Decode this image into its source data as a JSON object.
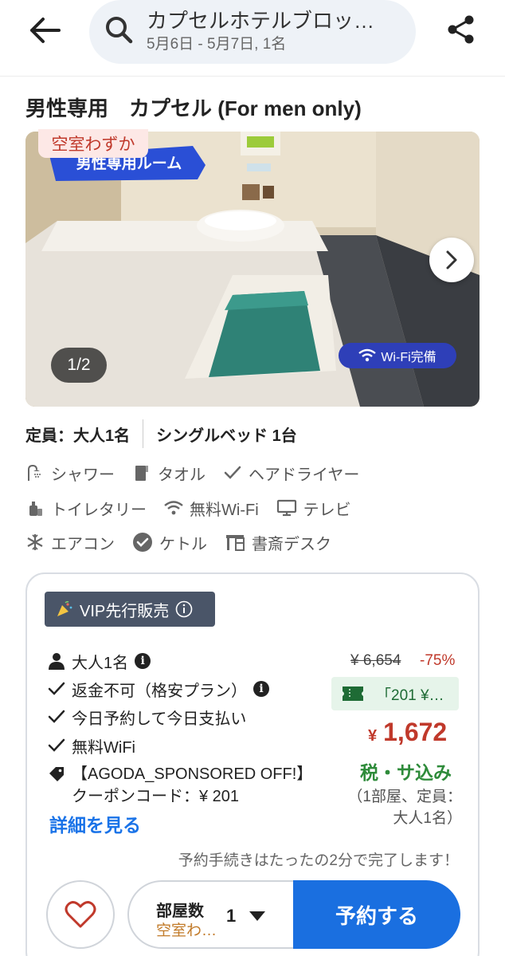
{
  "header": {
    "search_title": "カプセルホテルブロッ…",
    "search_subtitle": "5月6日 - 5月7日, 1名"
  },
  "room": {
    "title": "男性専用　カプセル (For men only)",
    "availability_badge": "空室わずか",
    "photo_banner": "男性専用ルーム",
    "photo_counter": "1/2",
    "wifi_tag": "Wi-Fi完備"
  },
  "capacity": {
    "occupancy": "定員：大人1名",
    "bed": "シングルベッド 1台"
  },
  "amenities": [
    {
      "label": "シャワー",
      "icon": "shower-icon"
    },
    {
      "label": "タオル",
      "icon": "towel-icon"
    },
    {
      "label": "ヘアドライヤー",
      "icon": "check-icon"
    },
    {
      "label": "トイレタリー",
      "icon": "toiletries-icon"
    },
    {
      "label": "無料Wi-Fi",
      "icon": "wifi-icon"
    },
    {
      "label": "テレビ",
      "icon": "tv-icon"
    },
    {
      "label": "エアコン",
      "icon": "snowflake-icon"
    },
    {
      "label": "ケトル",
      "icon": "check-circle-icon"
    },
    {
      "label": "書斎デスク",
      "icon": "desk-icon"
    }
  ],
  "offer": {
    "vip_label": "VIP先行販売",
    "conditions": {
      "guests": "大人1名",
      "refund": "返金不可（格安プラン）",
      "payment": "今日予約して今日支払い",
      "wifi": "無料WiFi"
    },
    "coupon_line1": "【AGODA_SPONSORED OFF!】",
    "coupon_line2": "クーポンコード：¥ 201",
    "details_link": "詳細を見る",
    "old_price": "¥ 6,654",
    "discount": "-75%",
    "coupon_tag": "「201 ¥…",
    "currency": "¥",
    "price": "1,672",
    "tax_note": "税・サ込み",
    "per_room": "（1部屋、定員：大人1名）",
    "notice": "予約手続きはたったの2分で完了します！"
  },
  "booking": {
    "rooms_label": "部屋数",
    "rooms_availability": "空室わ…",
    "rooms_count": "1",
    "book_button": "予約する"
  },
  "colors": {
    "accent_blue": "#1a6fe0",
    "price_red": "#c0392b",
    "tax_green": "#2e8b3a"
  }
}
